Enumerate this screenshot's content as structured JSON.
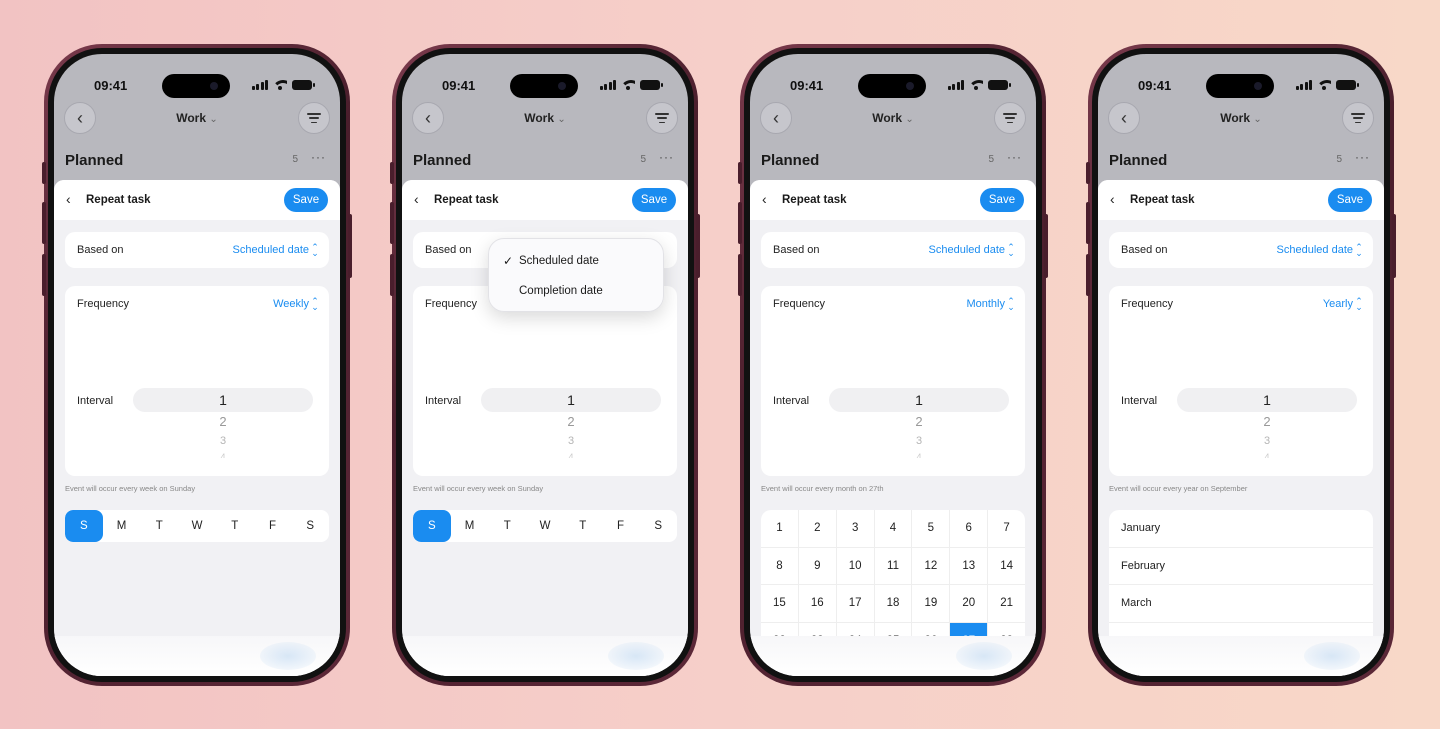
{
  "status": {
    "time": "09:41"
  },
  "nav": {
    "list_title": "Work",
    "chevron": "⌄",
    "section_title": "Planned",
    "count": "5",
    "more": "···"
  },
  "sheet": {
    "back": "‹",
    "title": "Repeat task",
    "save_label": "Save"
  },
  "based_on": {
    "label": "Based on",
    "value": "Scheduled date"
  },
  "dropdown": {
    "check": "✓",
    "options": [
      "Scheduled date",
      "Completion date"
    ]
  },
  "frequency_label": "Frequency",
  "interval": {
    "label": "Interval",
    "values": [
      "1",
      "2",
      "3",
      "4"
    ]
  },
  "days": [
    "S",
    "M",
    "T",
    "W",
    "T",
    "F",
    "S"
  ],
  "phones": [
    {
      "frequency": "Weekly",
      "note": "Event will occur every week on Sunday"
    },
    {
      "frequency": "Weekly",
      "note": "Event will occur every week on Sunday"
    },
    {
      "frequency": "Monthly",
      "note": "Event will occur every month on 27th"
    },
    {
      "frequency": "Yearly",
      "note": "Event will occur every year on September"
    }
  ],
  "calendar": {
    "rows": [
      [
        "1",
        "2",
        "3",
        "4",
        "5",
        "6",
        "7"
      ],
      [
        "8",
        "9",
        "10",
        "11",
        "12",
        "13",
        "14"
      ],
      [
        "15",
        "16",
        "17",
        "18",
        "19",
        "20",
        "21"
      ],
      [
        "22",
        "23",
        "24",
        "25",
        "26",
        "27",
        "28"
      ]
    ],
    "selected": "27"
  },
  "months": [
    "January",
    "February",
    "March",
    "April"
  ],
  "colors": {
    "accent": "#1a8cf0",
    "frame": "#5c2838"
  },
  "icons": {
    "back": "chevron-left-icon",
    "filter": "filter-icon",
    "signal": "signal-icon",
    "wifi": "wifi-icon",
    "battery": "battery-icon"
  }
}
